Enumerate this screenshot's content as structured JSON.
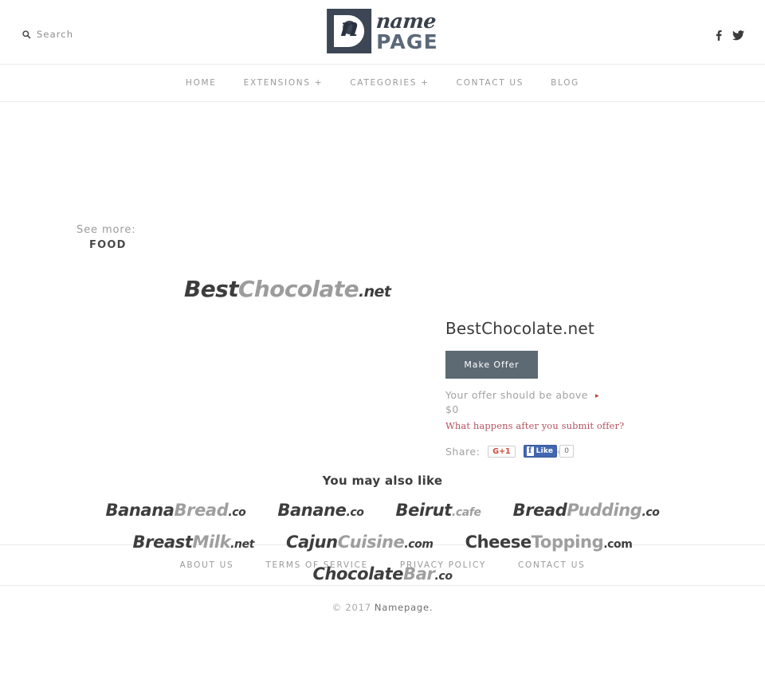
{
  "header": {
    "search": {
      "label": "Search",
      "icon": "search-icon"
    },
    "logo": {
      "mark_letter": "n",
      "name": "name",
      "page": "PAGE",
      "accent_color": "#3c4654"
    },
    "social": [
      {
        "name": "facebook-icon",
        "label": "f"
      },
      {
        "name": "twitter-icon",
        "label": "t"
      }
    ]
  },
  "nav": {
    "items": [
      {
        "label": "HOME"
      },
      {
        "label": "EXTENSIONS +"
      },
      {
        "label": "CATEGORIES +"
      },
      {
        "label": "CONTACT US"
      },
      {
        "label": "BLOG"
      }
    ]
  },
  "see_more": {
    "label": "See more:",
    "category": "FOOD"
  },
  "domain": {
    "logo_part_a": "Best",
    "logo_part_b": "Chocolate",
    "logo_tld": ".net",
    "title": "BestChocolate.net"
  },
  "offer": {
    "button_label": "Make Offer",
    "note": "Your offer should be above",
    "arrow": "▸",
    "amount": "$0",
    "link": "What happens after you submit offer?",
    "button_color": "#5d6a74",
    "link_color": "#b4525f"
  },
  "share": {
    "label": "Share:",
    "gplus_label": "G+1",
    "fb_f": "f",
    "fb_like_label": "Like",
    "fb_count": "0"
  },
  "related": {
    "title": "You may also like",
    "rows": [
      [
        {
          "a": "Banana",
          "b": "Bread",
          "tld": ".co",
          "italic": true
        },
        {
          "a": "Banane",
          "b": "",
          "tld": ".co",
          "italic": true
        },
        {
          "a": "Beirut",
          "b": "",
          "tld": ".cafe",
          "italic": true,
          "tld_gray": true
        },
        {
          "a": "Bread",
          "b": "Pudding",
          "tld": ".co",
          "italic": true
        }
      ],
      [
        {
          "a": "Breast",
          "b": "Milk",
          "tld": ".net",
          "italic": true
        },
        {
          "a": "Cajun",
          "b": "Cuisine",
          "tld": ".com",
          "italic": true
        },
        {
          "a": "Cheese",
          "b": "Topping",
          "tld": ".com",
          "italic": false
        }
      ],
      [
        {
          "a": "Chocolate",
          "b": "Bar",
          "tld": ".co",
          "italic": true
        }
      ]
    ]
  },
  "footer": {
    "links": [
      {
        "label": "ABOUT US"
      },
      {
        "label": "TERMS OF SERVICE"
      },
      {
        "label": "PRIVACY POLICY"
      },
      {
        "label": "CONTACT US"
      }
    ],
    "copyright_prefix": "© 2017",
    "copyright_brand": "Namepage."
  }
}
